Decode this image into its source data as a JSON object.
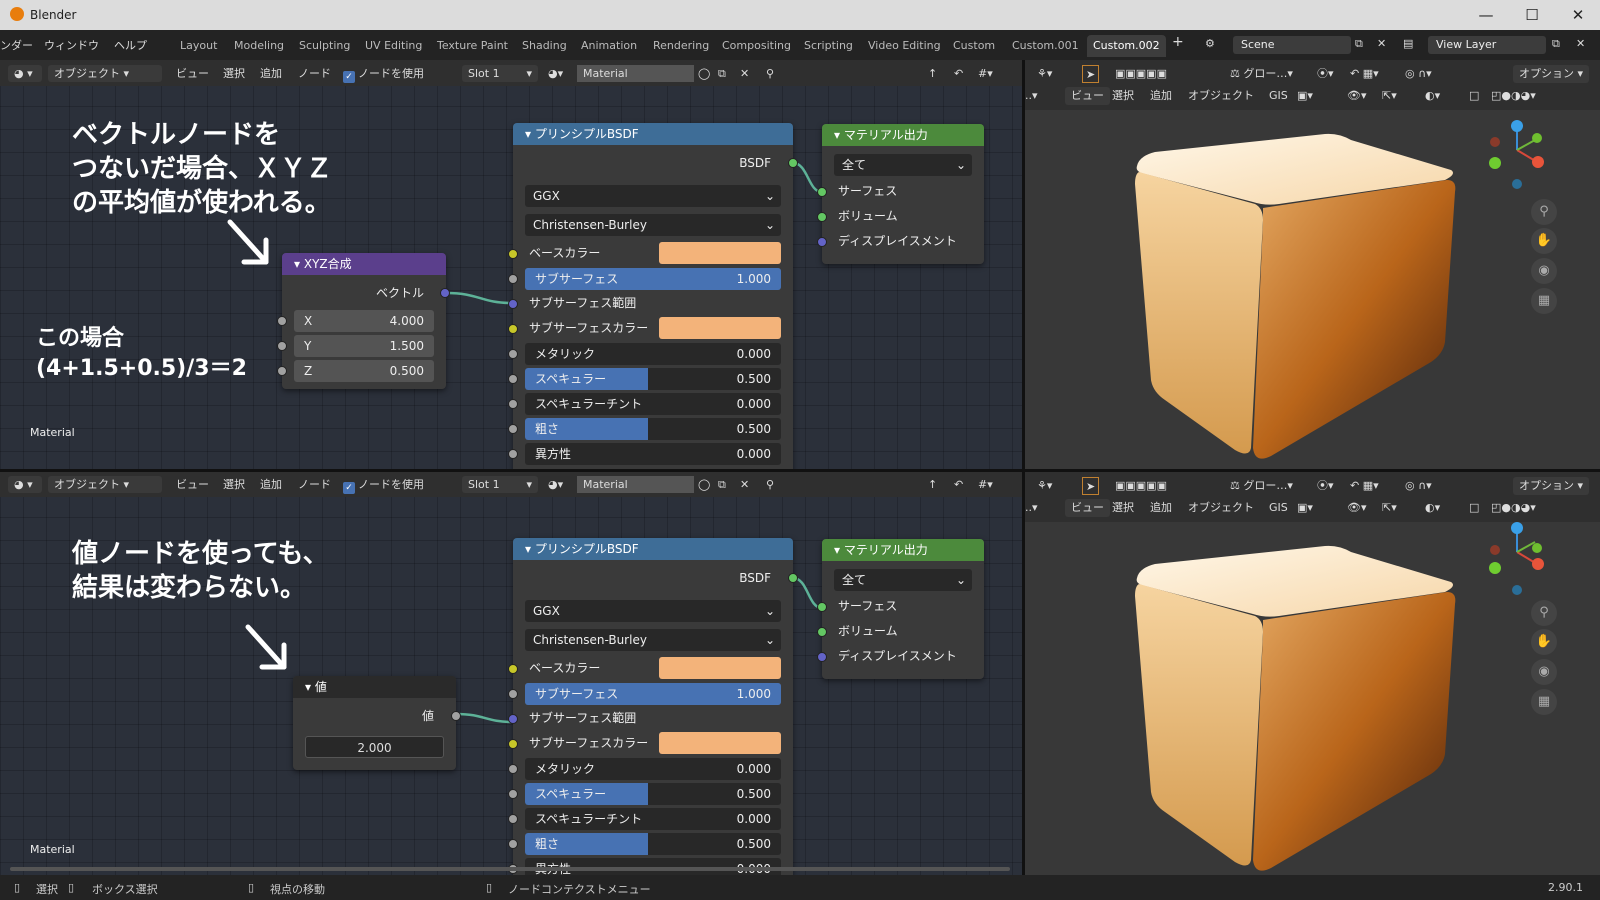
{
  "window": {
    "title": "Blender"
  },
  "topbar": {
    "menus": [
      "ンダー",
      "ウィンドウ",
      "ヘルプ"
    ],
    "tabs": [
      "Layout",
      "Modeling",
      "Sculpting",
      "UV Editing",
      "Texture Paint",
      "Shading",
      "Animation",
      "Rendering",
      "Compositing",
      "Scripting",
      "Video Editing",
      "Custom",
      "Custom.001",
      "Custom.002"
    ],
    "active_tab": "Custom.002",
    "scene": "Scene",
    "view_layer": "View Layer"
  },
  "node_header": {
    "mode": "オブジェクト",
    "view": "ビュー",
    "select": "選択",
    "add": "追加",
    "node": "ノード",
    "use_nodes": "ノードを使用",
    "slot": "Slot 1",
    "material": "Material"
  },
  "viewport_header": {
    "transform": "グロー…",
    "option": "オプション",
    "view": "ビュー",
    "select": "選択",
    "add": "追加",
    "object": "オブジェクト",
    "gis": "GIS"
  },
  "top": {
    "note": "ベクトルノードを\nつないだ場合、ＸＹＺ\nの平均値が使われる。",
    "note2": "この場合\n(4+1.5+0.5)/3＝2",
    "material_label": "Material",
    "xyz_node": {
      "title": "XYZ合成",
      "output": "ベクトル",
      "x_label": "X",
      "x": "4.000",
      "y_label": "Y",
      "y": "1.500",
      "z_label": "Z",
      "z": "0.500"
    }
  },
  "bottom": {
    "note": "値ノードを使っても、\n結果は変わらない。",
    "material_label": "Material",
    "value_node": {
      "title": "値",
      "output": "値",
      "value": "2.000"
    }
  },
  "bsdf": {
    "title": "プリンシプルBSDF",
    "output": "BSDF",
    "distribution": "GGX",
    "subsurface_method": "Christensen-Burley",
    "base_color": "ベースカラー",
    "subsurface": "サブサーフェス",
    "subsurface_val": "1.000",
    "subsurface_radius": "サブサーフェス範囲",
    "subsurface_color": "サブサーフェスカラー",
    "metallic": "メタリック",
    "metallic_val": "0.000",
    "specular": "スペキュラー",
    "specular_val": "0.500",
    "specular_tint": "スペキュラーチント",
    "specular_tint_val": "0.000",
    "roughness": "粗さ",
    "roughness_val": "0.500",
    "anisotropic": "異方性",
    "anisotropic_val": "0.000",
    "base_color_hex": "#f3b37a"
  },
  "output_node": {
    "title": "マテリアル出力",
    "target": "全て",
    "surface": "サーフェス",
    "volume": "ボリューム",
    "displacement": "ディスプレイスメント"
  },
  "status": {
    "select": "選択",
    "box_select": "ボックス選択",
    "move_view": "視点の移動",
    "context_menu": "ノードコンテクストメニュー",
    "version": "2.90.1"
  }
}
